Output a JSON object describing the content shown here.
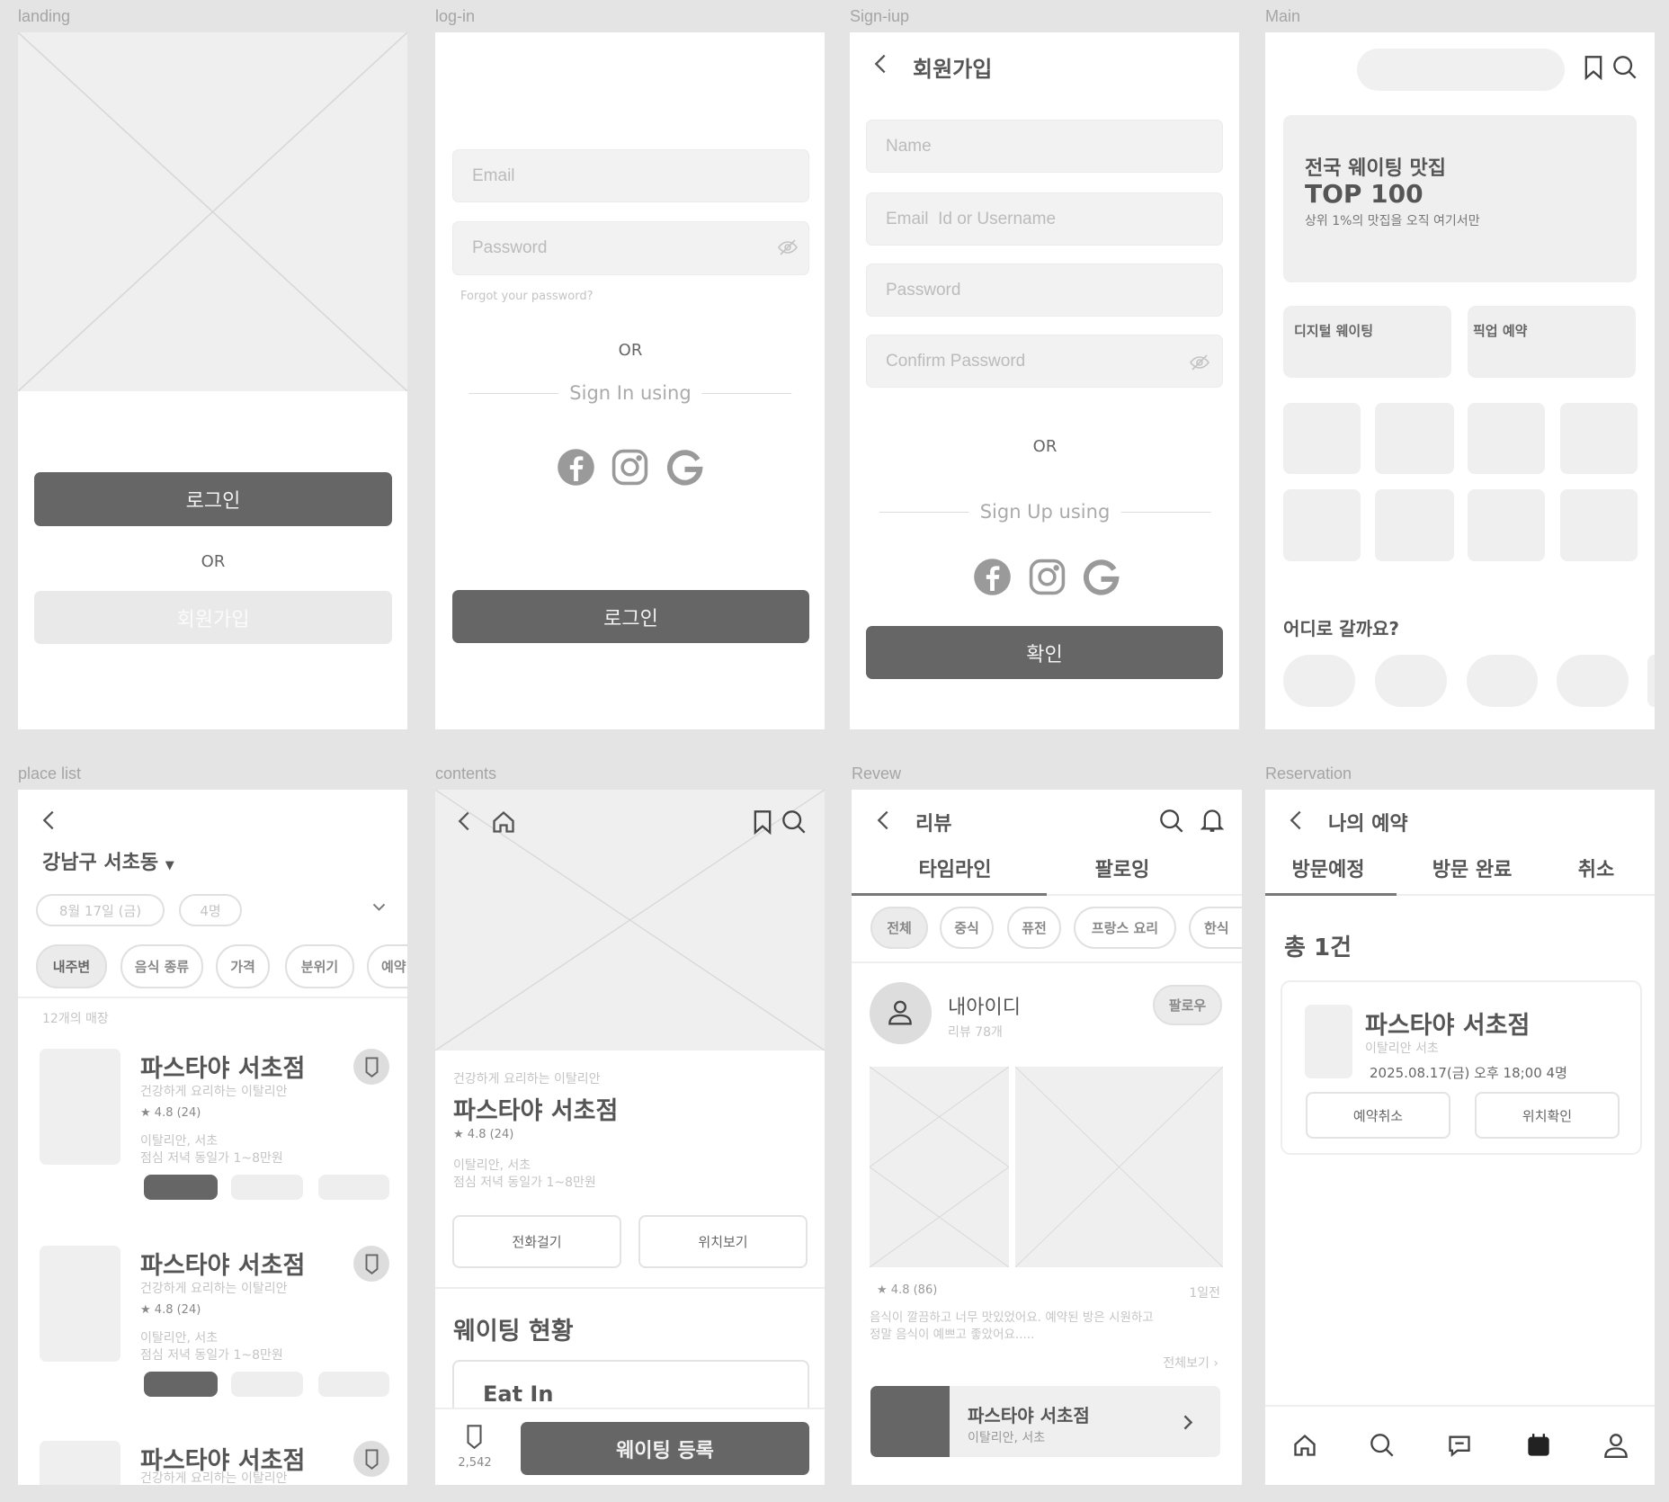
{
  "colors": {
    "background": "#e4e4e4",
    "panel": "#ffffff",
    "placeholder": "#efefef",
    "primary_button": "#666666",
    "text": "#444444"
  },
  "landing": {
    "label": "landing",
    "login_button": "로그인",
    "or": "OR",
    "signup_button": "회원가입"
  },
  "login": {
    "label": "log-in",
    "email_placeholder": "Email",
    "password_placeholder": "Password",
    "forgot_password": "Forgot your password?",
    "or": "OR",
    "sign_in_using": "Sign In using",
    "login_button": "로그인",
    "social": [
      "facebook-icon",
      "instagram-icon",
      "google-icon"
    ]
  },
  "signup": {
    "label": "Sign-iup",
    "title": "회원가입",
    "name_placeholder": "Name",
    "email_placeholder": "Email  Id or Username",
    "password_placeholder": "Password",
    "confirm_placeholder": "Confirm Password",
    "or": "OR",
    "sign_up_using": "Sign Up using",
    "confirm_button": "확인",
    "social": [
      "facebook-icon",
      "instagram-icon",
      "google-icon"
    ]
  },
  "main": {
    "label": "Main",
    "banner": {
      "title": "전국 웨이팅 맛집",
      "headline": "TOP 100",
      "subtitle": "상위 1%의 맛집을 오직 여기서만"
    },
    "cards": [
      "디지털 웨이팅",
      "픽업 예약"
    ],
    "where_title": "어디로 갈까요?"
  },
  "place_list": {
    "label": "place list",
    "location": "강남구 서초동",
    "date": "8월 17일 (금)",
    "people": "4명",
    "filters": [
      "내주변",
      "음식 종류",
      "가격",
      "분위기",
      "예약"
    ],
    "count": "12개의 매장",
    "items": [
      {
        "name": "파스타야 서초점",
        "tagline": "건강하게 요리하는 이탈리안",
        "rating": "4.8 (24)",
        "category": "이탈리안, 서초",
        "menu": "점심 저녁 동일가 1~8만원"
      },
      {
        "name": "파스타야 서초점",
        "tagline": "건강하게 요리하는 이탈리안",
        "rating": "4.8 (24)",
        "category": "이탈리안, 서초",
        "menu": "점심 저녁 동일가 1~8만원"
      },
      {
        "name": "파스타야 서초점",
        "tagline": "건강하게 요리하는 이탈리안"
      }
    ]
  },
  "contents": {
    "label": "contents",
    "tagline": "건강하게 요리하는 이탈리안",
    "name": "파스타야 서초점",
    "rating": "4.8 (24)",
    "category": "이탈리안, 서초",
    "menu": "점심 저녁 동일가 1~8만원",
    "call_button": "전화걸기",
    "map_button": "위치보기",
    "waiting_title": "웨이팅 현황",
    "eat_in": "Eat In",
    "bookmark_count": "2,542",
    "register_button": "웨이팅 등록"
  },
  "review": {
    "label": "Revew",
    "title": "리뷰",
    "tabs": [
      "타임라인",
      "팔로잉"
    ],
    "active_tab": "타임라인",
    "chips": [
      "전체",
      "중식",
      "퓨전",
      "프랑스 요리",
      "한식"
    ],
    "user": "내아이디",
    "user_reviews": "리뷰 78개",
    "follow_button": "팔로우",
    "rating": "4.8 (86)",
    "time": "1일전",
    "text_line1": "음식이 깔끔하고 너무 맛있었어요. 예약된 방은 시원하고",
    "text_line2": "정말 음식이 예쁘고 좋았어요.....",
    "see_all": "전체보기",
    "place_name": "파스타야 서초점",
    "place_category": "이탈리안, 서초"
  },
  "reservation": {
    "label": "Reservation",
    "title": "나의 예약",
    "tabs": [
      "방문예정",
      "방문 완료",
      "취소"
    ],
    "active_tab": "방문예정",
    "total": "총 1건",
    "place_name": "파스타야 서초점",
    "place_category": "이탈리안  서초",
    "datetime": "2025.08.17(금)  오후 18;00  4명",
    "cancel_button": "예약취소",
    "location_button": "위치확인",
    "nav": [
      "home-icon",
      "search-icon",
      "chat-icon",
      "calendar-icon",
      "person-icon"
    ],
    "active_nav": "calendar-icon"
  }
}
